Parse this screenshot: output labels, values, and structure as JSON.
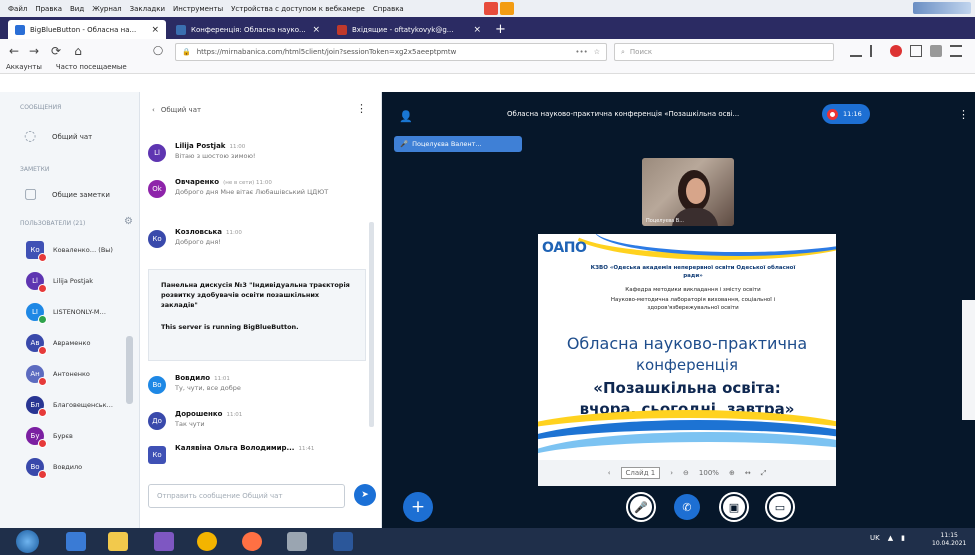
{
  "menubar": {
    "items": [
      "Файл",
      "Правка",
      "Вид",
      "Журнал",
      "Закладки",
      "Инструменты",
      "Устройства с доступом к вебкамере",
      "Справка"
    ]
  },
  "tabs": [
    {
      "title": "BigBlueButton - Обласна на...",
      "fav_color": "#2b6fd6"
    },
    {
      "title": "Конференція: Обласна науко...",
      "fav_color": "#3a6fb0"
    },
    {
      "title": "Вхідящие - oftatykovyk@g...",
      "fav_color": "#c0392b"
    }
  ],
  "navbar": {
    "url": "https://mirnabanica.com/html5client/join?sessionToken=xg2x5aeeptpmtw",
    "url_more": "•••",
    "search_placeholder": "Поиск",
    "bookmarks": [
      "Аккаунты",
      "Часто посещаемые"
    ]
  },
  "sidebar": {
    "messages_header": "СООБЩЕНИЯ",
    "public_chat_label": "Общий чат",
    "notes_header": "ЗАМЕТКИ",
    "shared_notes_label": "Общие заметки",
    "users_header": "ПОЛЬЗОВАТЕЛИ (21)",
    "users": [
      {
        "initials": "Ко",
        "name": "Коваленко… (Вы)",
        "color": "#3f51b5",
        "mic": "off",
        "square": true
      },
      {
        "initials": "Ll",
        "name": "Lilija Postjak",
        "color": "#5e35b1",
        "mic": "off",
        "square": false
      },
      {
        "initials": "LI",
        "name": "LISTENONLY-М…",
        "color": "#1e88e5",
        "mic": "on",
        "square": false
      },
      {
        "initials": "Ав",
        "name": "Авраменко",
        "color": "#3949ab",
        "mic": "off",
        "square": false
      },
      {
        "initials": "Ан",
        "name": "Антоненко",
        "color": "#5c6bc0",
        "mic": "off",
        "square": false
      },
      {
        "initials": "Бл",
        "name": "Благовещенськ…",
        "color": "#283593",
        "mic": "off",
        "square": false
      },
      {
        "initials": "Бу",
        "name": "Бурєв",
        "color": "#7b1fa2",
        "mic": "off",
        "square": false
      },
      {
        "initials": "Во",
        "name": "Вовдило",
        "color": "#3949ab",
        "mic": "off",
        "square": false
      }
    ]
  },
  "chat": {
    "header": "Общий чат",
    "messages": [
      {
        "initials": "Ll",
        "color": "#5e35b1",
        "name": "Lilija Postjak",
        "time": "11:00",
        "text": "Вітаю з шостою зимою!"
      },
      {
        "initials": "Ok",
        "color": "#8e24aa",
        "name": "Овчаренко",
        "time": "(не в сети) 11:00",
        "text": "Доброго дня Мне вітає Любашівський ЦДЮТ"
      },
      {
        "initials": "Ко",
        "color": "#3949ab",
        "name": "Козловська",
        "time": "11:00",
        "text": "Доброго дня!"
      },
      {
        "initials": "Во",
        "color": "#1e88e5",
        "name": "Вовдило",
        "time": "11:01",
        "text": "Ту, чути, все добре"
      },
      {
        "initials": "До",
        "color": "#3949ab",
        "name": "Дорошенко",
        "time": "11:01",
        "text": "Так чути"
      },
      {
        "initials": "Ко",
        "color": "#3f51b5",
        "name": "Калявіна Ольга Володимир...",
        "time": "11:41",
        "text": ""
      }
    ],
    "welcome_line1": "Панельна дискусія №3 \"Індивідуальна траєкторія розвитку здобувачів освіти позашкільних закладів\"",
    "welcome_line2": "This server is running BigBlueButton.",
    "input_placeholder": "Отправить сообщение Общий чат",
    "send_icon": "send-icon"
  },
  "stage": {
    "title": "Обласна науково-практична конференція «Позашкільна осві...",
    "record_label": "11:16",
    "talking_label": "Поцелуєва Валент...",
    "webcam_label": "Поцелуєва В...",
    "slide": {
      "logo": "ОАПО",
      "sub1": "КЗВО «Одеська академія неперервної освіти Одеської обласної ради»",
      "sub2": "Кафедра методики викладання і змісту освіти",
      "sub3": "Науково-методична лабораторія виховання, соціальної і здоров'язбережувальної освіти",
      "title1": "Обласна науково-практична",
      "title2": "конференція",
      "title3": "«Позашкільна освіта:",
      "title4": "вчора, сьогодні, завтра»"
    },
    "slide_toolbar": {
      "slide_label": "Слайд 1",
      "zoom": "100%"
    }
  },
  "taskbar": {
    "lang": "UK",
    "time": "11:15",
    "date": "10.04.2021"
  }
}
